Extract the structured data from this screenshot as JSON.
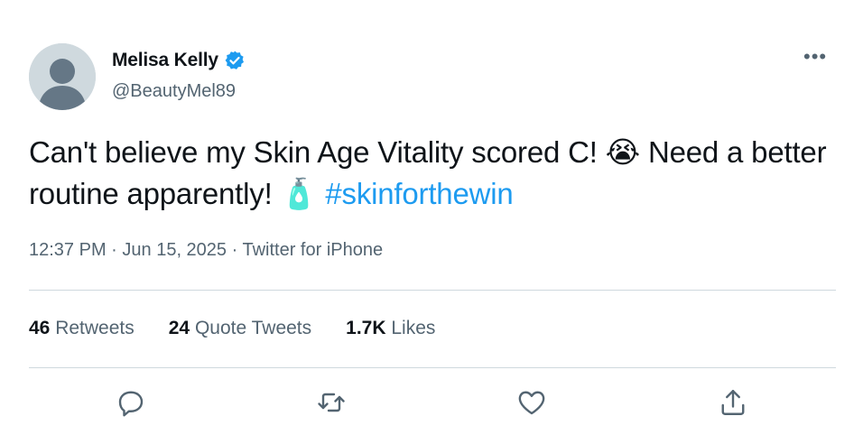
{
  "author": {
    "display_name": "Melisa Kelly",
    "handle": "@BeautyMel89",
    "verified": true,
    "avatar_icon": "default-avatar-icon"
  },
  "tweet": {
    "text_part1": "Can't believe my Skin Age Vitality scored C! ",
    "emoji1": "😭",
    "text_part2": " Need a better routine apparently! ",
    "emoji2": "🧴",
    "hashtag": "#skinforthewin"
  },
  "meta": {
    "time": "12:37 PM",
    "sep1": " · ",
    "date": "Jun 15, 2025",
    "sep2": " · ",
    "source": "Twitter for iPhone"
  },
  "stats": {
    "retweets_count": "46",
    "retweets_label": "Retweets",
    "quotes_count": "24",
    "quotes_label": "Quote Tweets",
    "likes_count": "1.7K",
    "likes_label": "Likes"
  },
  "menu": {
    "more_label": "•••"
  },
  "colors": {
    "accent": "#1d9bf0",
    "muted": "#536471",
    "divider": "#cfd9de"
  }
}
